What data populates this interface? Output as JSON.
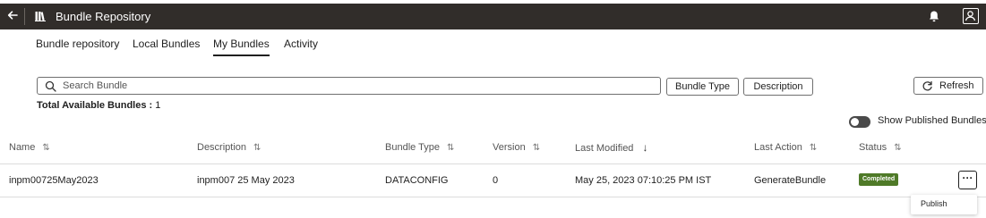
{
  "header": {
    "title": "Bundle Repository",
    "back_icon": "arrow-left-icon",
    "app_icon": "library-icon",
    "notification_icon": "bell-icon",
    "user_icon": "user-avatar-icon",
    "background": "#312d2a"
  },
  "tabs": [
    {
      "label": "Bundle repository",
      "active": false
    },
    {
      "label": "Local Bundles",
      "active": false
    },
    {
      "label": "My Bundles",
      "active": true
    },
    {
      "label": "Activity",
      "active": false
    }
  ],
  "search": {
    "placeholder": "Search Bundle",
    "value": ""
  },
  "filters": {
    "bundle_type_label": "Bundle Type",
    "description_label": "Description"
  },
  "refresh": {
    "label": "Refresh",
    "icon": "refresh-icon"
  },
  "summary": {
    "label": "Total Available Bundles :",
    "count": "1"
  },
  "show_published": {
    "label": "Show Published Bundles",
    "enabled": false
  },
  "table": {
    "columns": [
      "Name",
      "Description",
      "Bundle Type",
      "Version",
      "Last Modified",
      "Last Action",
      "Status"
    ],
    "sorted_column": "Last Modified",
    "sort_direction": "descending",
    "rows": [
      {
        "name": "inpm00725May2023",
        "description": "inpm007 25 May 2023",
        "bundle_type": "DATACONFIG",
        "version": "0",
        "last_modified": "May 25, 2023 07:10:25 PM IST",
        "last_action": "GenerateBundle",
        "status": "Completed",
        "status_color": "#4f7a28"
      }
    ]
  },
  "row_menu": {
    "more_icon": "ellipsis-icon",
    "items": [
      "Publish"
    ]
  }
}
